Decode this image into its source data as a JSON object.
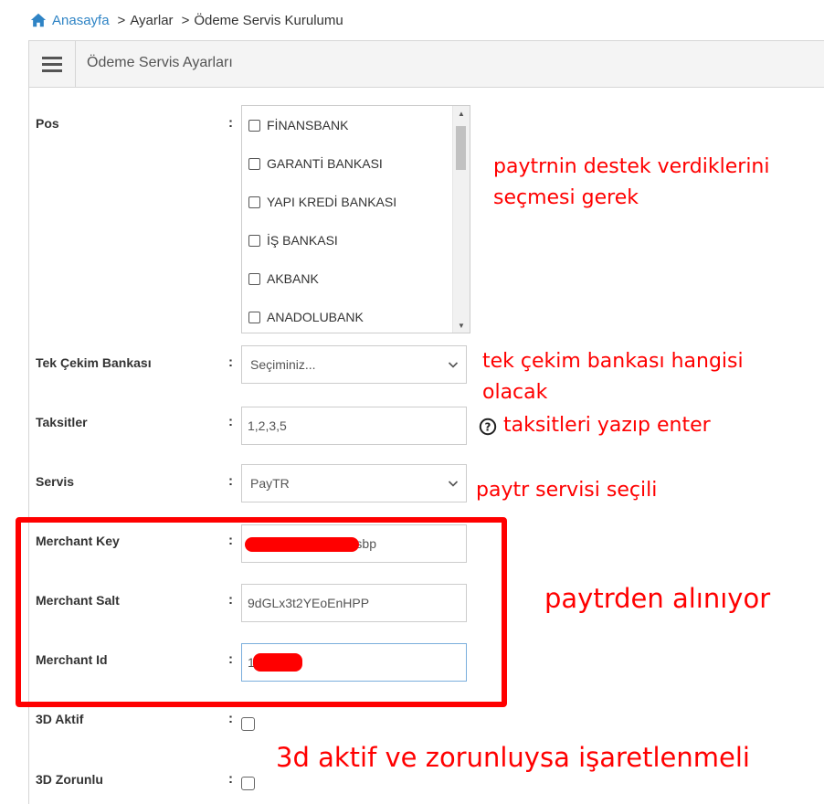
{
  "breadcrumb": {
    "home_label": "Anasayfa",
    "items": [
      "Ayarlar",
      "Ödeme Servis Kurulumu"
    ],
    "separator": ">"
  },
  "panel": {
    "title": "Ödeme Servis Ayarları",
    "menu_icon": "hamburger-icon"
  },
  "form": {
    "colon": ":",
    "pos": {
      "label": "Pos",
      "options": [
        "FİNANSBANK",
        "GARANTİ BANKASI",
        "YAPI KREDİ BANKASI",
        "İŞ BANKASI",
        "AKBANK",
        "ANADOLUBANK"
      ]
    },
    "tek_cekim": {
      "label": "Tek Çekim Bankası",
      "value": "Seçiminiz..."
    },
    "taksitler": {
      "label": "Taksitler",
      "value": "1,2,3,5"
    },
    "servis": {
      "label": "Servis",
      "value": "PayTR"
    },
    "merchant_key": {
      "label": "Merchant Key",
      "value": "sbp"
    },
    "merchant_salt": {
      "label": "Merchant Salt",
      "value": "9dGLx3t2YEoEnHPP"
    },
    "merchant_id": {
      "label": "Merchant Id",
      "value": "1"
    },
    "aktif_3d": {
      "label": "3D Aktif",
      "checked": false
    },
    "zorunlu_3d": {
      "label": "3D Zorunlu",
      "checked": false
    }
  },
  "annotations": {
    "pos_note_line1": "paytrnin destek verdiklerini",
    "pos_note_line2": "seçmesi gerek",
    "tek_cekim_line1": "tek çekim bankası hangisi",
    "tek_cekim_line2": "olacak",
    "taksit_note": "taksitleri yazıp enter",
    "servis_note": "paytr servisi seçili",
    "merchant_note": "paytrden alınıyor",
    "threed_note": "3d aktif ve zorunluysa işaretlenmeli"
  },
  "colors": {
    "link": "#2f84c5",
    "annotation": "#ff0000",
    "header_bg": "#f4f4f4"
  }
}
